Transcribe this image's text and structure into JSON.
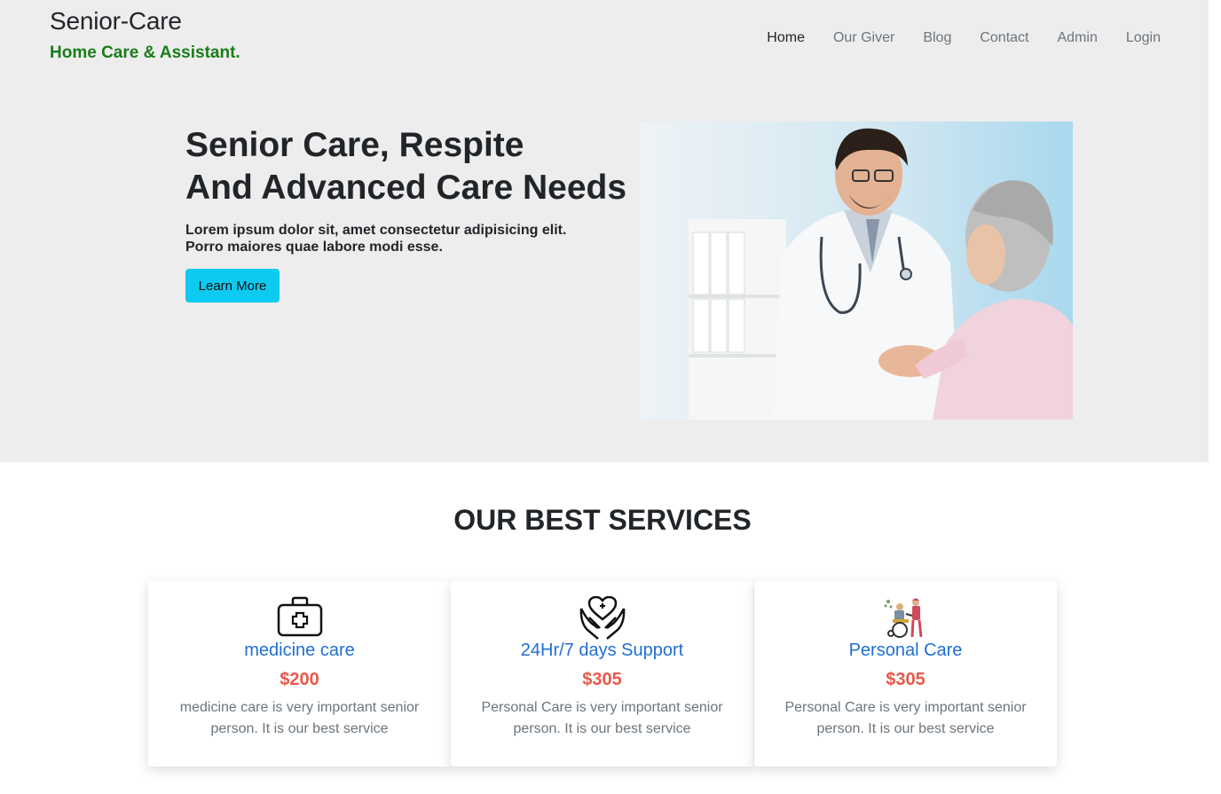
{
  "brand": {
    "title": "Senior-Care",
    "tagline": "Home Care & Assistant."
  },
  "nav": {
    "items": [
      "Home",
      "Our Giver",
      "Blog",
      "Contact",
      "Admin",
      "Login"
    ]
  },
  "hero": {
    "title_line1": "Senior Care, Respite",
    "title_line2": "And Advanced Care Needs",
    "text": "Lorem ipsum dolor sit, amet consectetur adipisicing elit. Porro maiores quae labore modi esse.",
    "button": "Learn More"
  },
  "services": {
    "title": "OUR BEST SERVICES",
    "cards": [
      {
        "icon": "first-aid-kit-icon",
        "name": "medicine care",
        "price": "$200",
        "desc": "medicine care is very important senior person. It is our best service"
      },
      {
        "icon": "hands-heart-icon",
        "name": "24Hr/7 days Support",
        "price": "$305",
        "desc": "Personal Care is very important senior person. It is our best service"
      },
      {
        "icon": "wheelchair-caregiver-icon",
        "name": "Personal Care",
        "price": "$305",
        "desc": "Personal Care is very important senior person. It is our best service"
      }
    ]
  },
  "colors": {
    "accent": "#0dcaf0",
    "brand_green": "#1a7d1a",
    "service_blue": "#1f6fd1",
    "price_red": "#e8594a",
    "hero_bg": "#ededed"
  }
}
